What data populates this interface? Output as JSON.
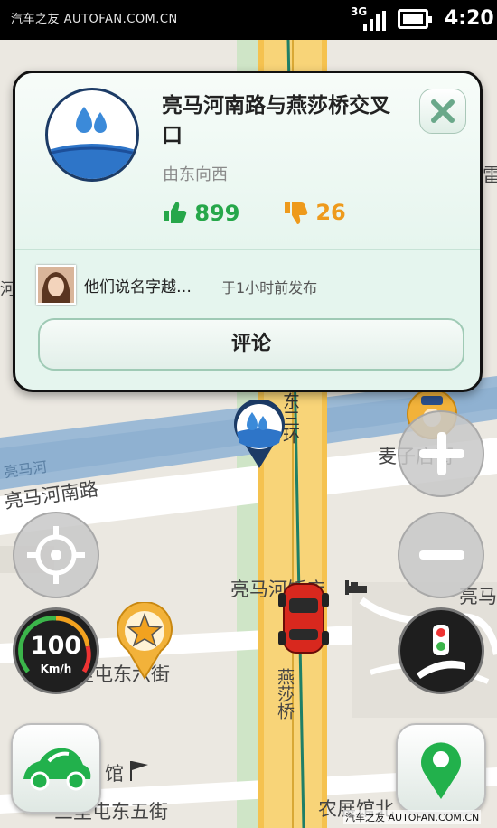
{
  "status_bar": {
    "watermark": "汽车之友 AUTOFAN.COM.CN",
    "network": "3G",
    "time": "4:20"
  },
  "map": {
    "labels": {
      "road_liangmahe_south": "亮马河南路",
      "river": "亮马河",
      "hotel": "亮马河饭店",
      "east_3rd_ring_partial": "东三环",
      "maizi_street_partial": "麦子店街",
      "liangma_right": "亮马",
      "nongzhan_6th": "农展馆北",
      "sanlitun_6th": "三里屯东六街",
      "sanlitun_5th": "三里屯东五街",
      "yansha_bridge": "燕莎桥",
      "guan": "馆",
      "lei_partial": "雷",
      "he_partial": "河"
    }
  },
  "report_card": {
    "title": "亮马河南路与燕莎桥交叉口",
    "direction": "由东向西",
    "likes": "899",
    "dislikes": "26",
    "message_preview": "他们说名字越…",
    "posted_time": "于1小时前发布",
    "comment_label": "评论",
    "icon": "water-drop-icon"
  },
  "controls": {
    "speed_value": "100",
    "speed_unit": "Km/h",
    "zoom_in": "plus-icon",
    "zoom_out": "minus-icon",
    "locate": "crosshair-icon",
    "traffic": "traffic-light-icon",
    "car_menu": "car-icon",
    "report": "map-pin-icon"
  },
  "footer_watermark": "汽车之友 AUTOFAN.COM.CN",
  "colors": {
    "accent_green": "#26a74a",
    "dislike_orange": "#ee9a1c",
    "road_yellow": "#f6c85a",
    "water_blue": "#7ea6c9"
  }
}
